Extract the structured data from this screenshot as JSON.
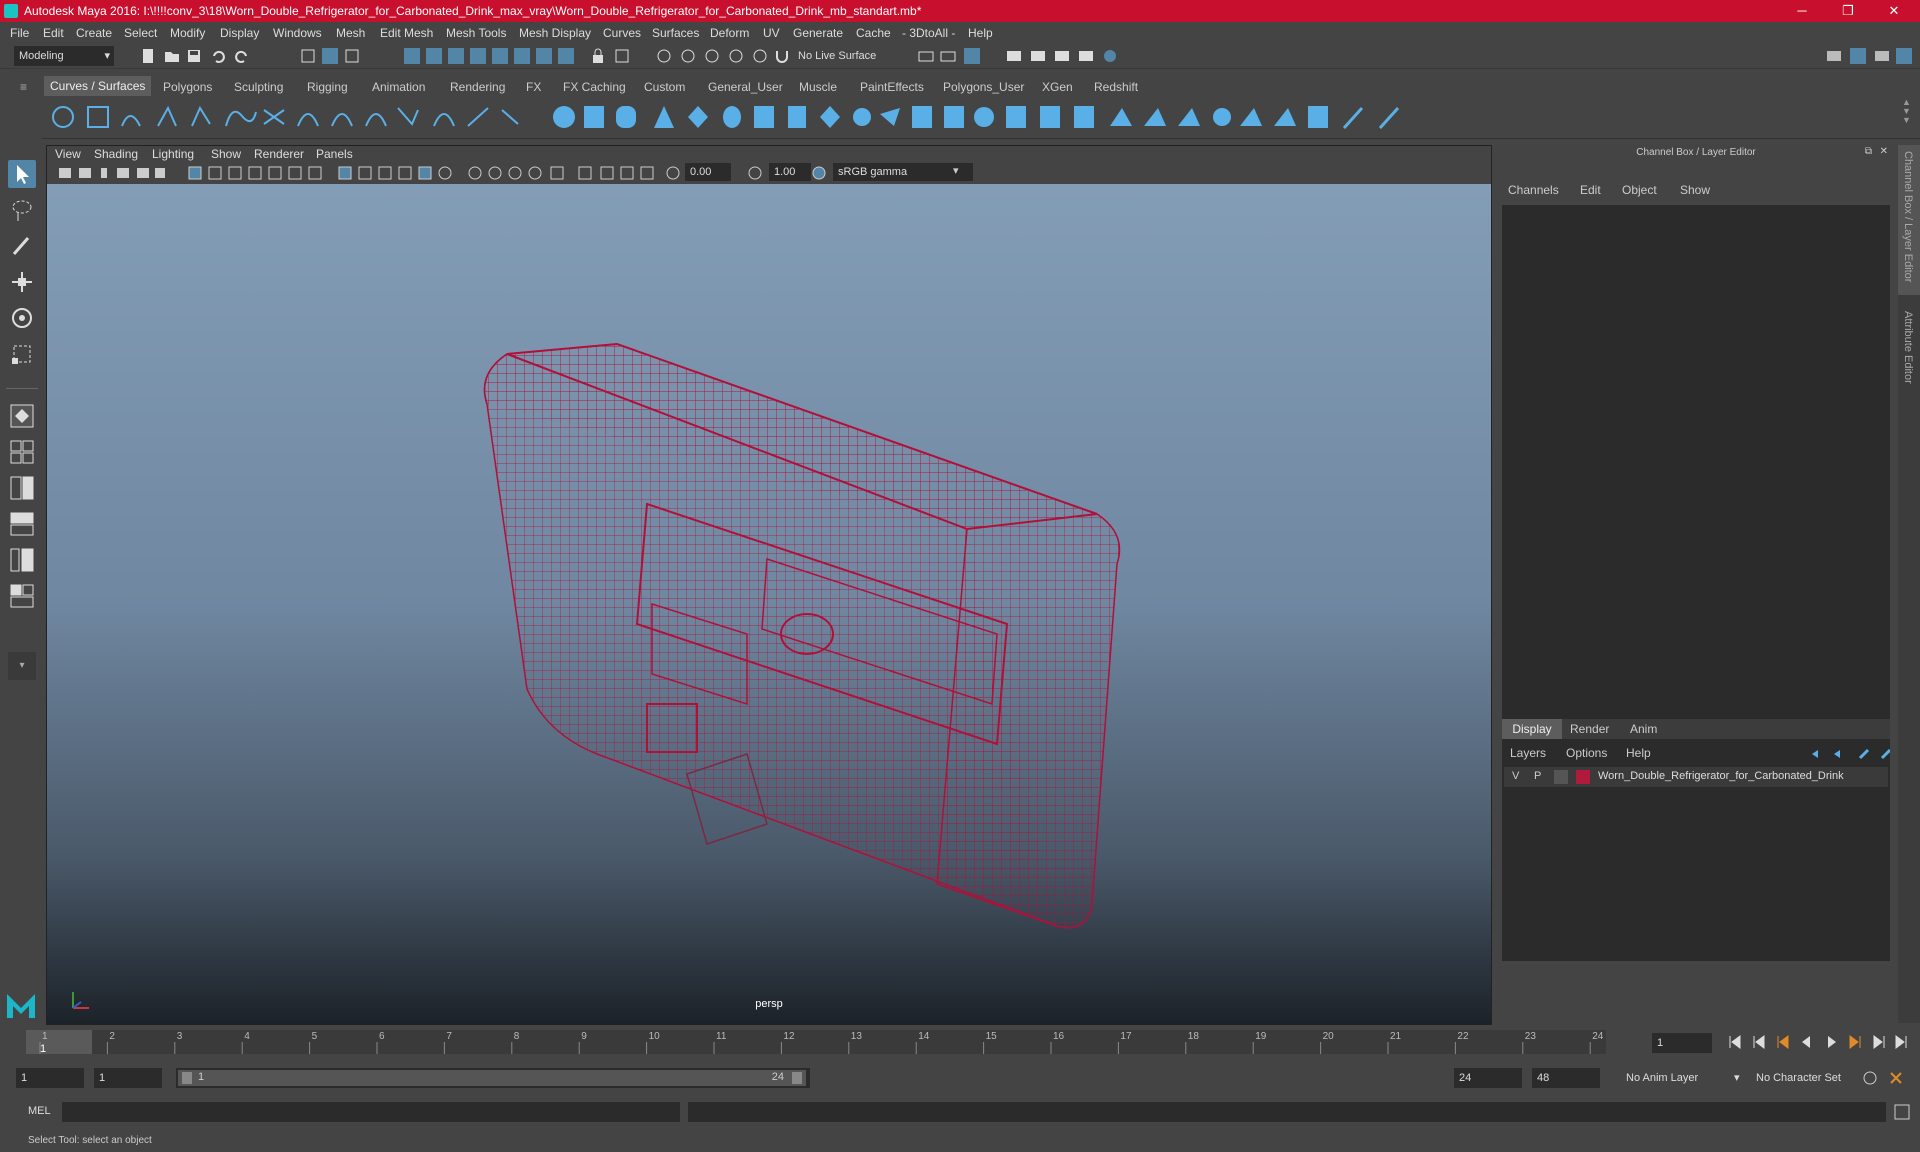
{
  "titlebar": {
    "title": "Autodesk Maya 2016: I:\\!!!!conv_3\\18\\Worn_Double_Refrigerator_for_Carbonated_Drink_max_vray\\Worn_Double_Refrigerator_for_Carbonated_Drink_mb_standart.mb*",
    "minimize": "─",
    "maximize": "❐",
    "close": "✕"
  },
  "menubar": [
    "File",
    "Edit",
    "Create",
    "Select",
    "Modify",
    "Display",
    "Windows",
    "Mesh",
    "Edit Mesh",
    "Mesh Tools",
    "Mesh Display",
    "Curves",
    "Surfaces",
    "Deform",
    "UV",
    "Generate",
    "Cache",
    "- 3DtoAll -",
    "Help"
  ],
  "statusline": {
    "mode": "Modeling",
    "live_surface": "No Live Surface"
  },
  "shelf_tabs": [
    "Curves / Surfaces",
    "Polygons",
    "Sculpting",
    "Rigging",
    "Animation",
    "Rendering",
    "FX",
    "FX Caching",
    "Custom",
    "General_User",
    "Muscle",
    "PaintEffects",
    "Polygons_User",
    "XGen",
    "Redshift"
  ],
  "viewport": {
    "menu": [
      "View",
      "Shading",
      "Lighting",
      "Show",
      "Renderer",
      "Panels"
    ],
    "exposure": "0.00",
    "gamma": "1.00",
    "colorspace": "sRGB gamma",
    "camera_label": "persp"
  },
  "channel_box": {
    "title": "Channel Box / Layer Editor",
    "menu": [
      "Channels",
      "Edit",
      "Object",
      "Show"
    ]
  },
  "layer_editor": {
    "tabs": [
      "Display",
      "Render",
      "Anim"
    ],
    "menu": [
      "Layers",
      "Options",
      "Help"
    ],
    "layer": {
      "visible": "V",
      "playback": "P",
      "color": "#b01a3c",
      "name": "Worn_Double_Refrigerator_for_Carbonated_Drink"
    }
  },
  "side_tabs": [
    "Channel Box / Layer Editor",
    "Attribute Editor"
  ],
  "timeline": {
    "ticks": [
      "1",
      "2",
      "3",
      "4",
      "5",
      "6",
      "7",
      "8",
      "9",
      "10",
      "11",
      "12",
      "13",
      "14",
      "15",
      "16",
      "17",
      "18",
      "19",
      "20",
      "21",
      "22",
      "23",
      "24"
    ],
    "current_frame": "1",
    "current_field": "1"
  },
  "range": {
    "start": "1",
    "playback_start": "1",
    "slider_start": "1",
    "slider_end": "24",
    "playback_end": "24",
    "end": "48",
    "anim_layer": "No Anim Layer",
    "character_set": "No Character Set"
  },
  "command": {
    "label": "MEL"
  },
  "help_line": "Select Tool: select an object",
  "colors": {
    "title_bar": "#c8102e",
    "wireframe": "#b0103a",
    "accent": "#5285a6"
  }
}
